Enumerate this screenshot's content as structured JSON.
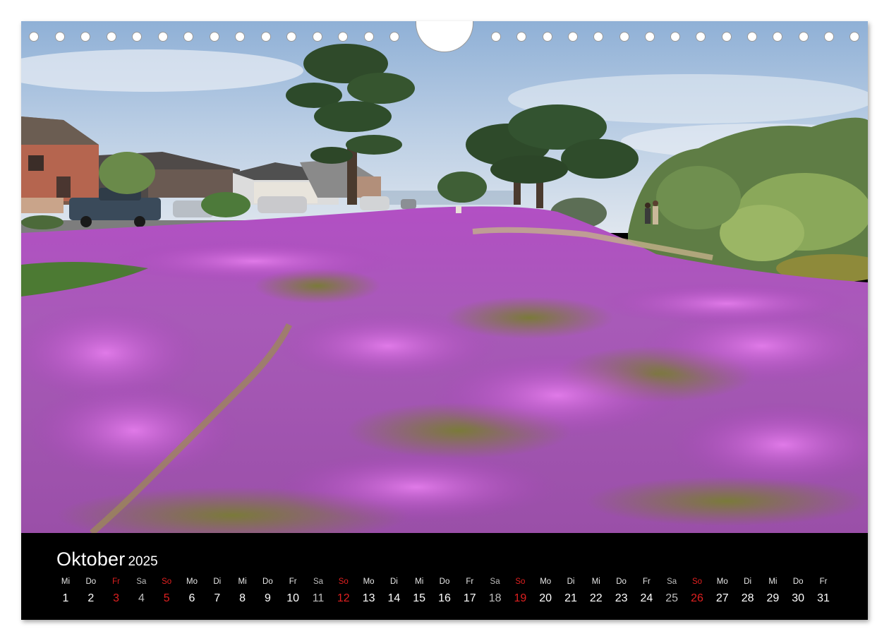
{
  "calendar": {
    "month": "Oktober",
    "year": "2025",
    "days": [
      {
        "dow": "Mi",
        "num": "1",
        "kind": "weekday"
      },
      {
        "dow": "Do",
        "num": "2",
        "kind": "weekday"
      },
      {
        "dow": "Fr",
        "num": "3",
        "kind": "holiday"
      },
      {
        "dow": "Sa",
        "num": "4",
        "kind": "saturday"
      },
      {
        "dow": "So",
        "num": "5",
        "kind": "sunday"
      },
      {
        "dow": "Mo",
        "num": "6",
        "kind": "weekday"
      },
      {
        "dow": "Di",
        "num": "7",
        "kind": "weekday"
      },
      {
        "dow": "Mi",
        "num": "8",
        "kind": "weekday"
      },
      {
        "dow": "Do",
        "num": "9",
        "kind": "weekday"
      },
      {
        "dow": "Fr",
        "num": "10",
        "kind": "weekday"
      },
      {
        "dow": "Sa",
        "num": "11",
        "kind": "saturday"
      },
      {
        "dow": "So",
        "num": "12",
        "kind": "sunday"
      },
      {
        "dow": "Mo",
        "num": "13",
        "kind": "weekday"
      },
      {
        "dow": "Di",
        "num": "14",
        "kind": "weekday"
      },
      {
        "dow": "Mi",
        "num": "15",
        "kind": "weekday"
      },
      {
        "dow": "Do",
        "num": "16",
        "kind": "weekday"
      },
      {
        "dow": "Fr",
        "num": "17",
        "kind": "weekday"
      },
      {
        "dow": "Sa",
        "num": "18",
        "kind": "saturday"
      },
      {
        "dow": "So",
        "num": "19",
        "kind": "sunday"
      },
      {
        "dow": "Mo",
        "num": "20",
        "kind": "weekday"
      },
      {
        "dow": "Di",
        "num": "21",
        "kind": "weekday"
      },
      {
        "dow": "Mi",
        "num": "22",
        "kind": "weekday"
      },
      {
        "dow": "Do",
        "num": "23",
        "kind": "weekday"
      },
      {
        "dow": "Fr",
        "num": "24",
        "kind": "weekday"
      },
      {
        "dow": "Sa",
        "num": "25",
        "kind": "saturday"
      },
      {
        "dow": "So",
        "num": "26",
        "kind": "sunday"
      },
      {
        "dow": "Mo",
        "num": "27",
        "kind": "weekday"
      },
      {
        "dow": "Di",
        "num": "28",
        "kind": "weekday"
      },
      {
        "dow": "Mi",
        "num": "29",
        "kind": "weekday"
      },
      {
        "dow": "Do",
        "num": "30",
        "kind": "weekday"
      },
      {
        "dow": "Fr",
        "num": "31",
        "kind": "weekday"
      }
    ]
  },
  "colors": {
    "sunday_holiday": "#e02020",
    "saturday": "#bdbdbd",
    "weekday": "#ffffff",
    "calendar_background": "#000000",
    "flower_magenta": "#b248c8"
  },
  "photo": {
    "icon": "purple-ice-plant-field-photo"
  }
}
